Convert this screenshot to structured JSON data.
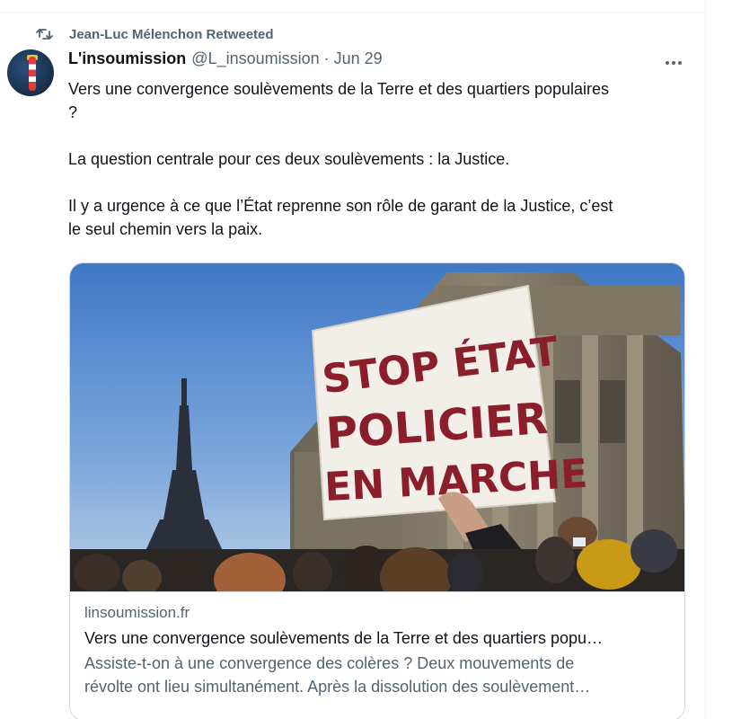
{
  "retweet": {
    "icon": "retweet-icon",
    "label": "Jean-Luc Mélenchon Retweeted"
  },
  "tweet": {
    "author_name": "L'insoumission",
    "author_handle": "@L_insoumission",
    "separator": "·",
    "date": "Jun 29",
    "more_icon": "more-dots-icon",
    "text": {
      "line1": "Vers une convergence soulèvements de la Terre et des quartiers populaires",
      "line2": "?",
      "para2": "La question centrale pour ces deux soulèvements : la Justice.",
      "para3_line1": "Il y a urgence à ce que l’État reprenne son rôle de garant de la Justice, c’est",
      "para3_line2": "le seul chemin vers la paix."
    }
  },
  "card": {
    "sign": {
      "line1": "STOP ÉTAT",
      "line2": "POLICIER",
      "line3": "EN MARCHE"
    },
    "domain": "linsoumission.fr",
    "title": "Vers une convergence soulèvements de la Terre et des quartiers popu…",
    "description_line1": "Assiste-t-on à une convergence des colères ? Deux mouvements de",
    "description_line2": "révolte ont lieu simultanément. Après la dissolution des soulèvement…"
  },
  "colors": {
    "text_primary": "#0f1419",
    "text_secondary": "#536471",
    "border": "#cfd9de",
    "sign_ink": "#8b1e2b"
  }
}
